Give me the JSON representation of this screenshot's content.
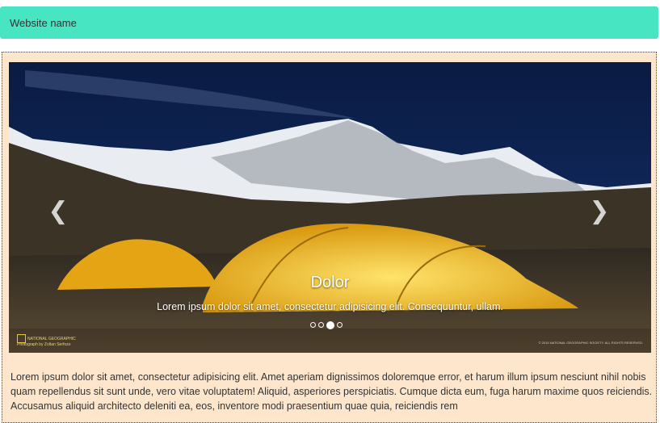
{
  "header": {
    "site_name": "Website name"
  },
  "carousel": {
    "caption_title": "Dolor",
    "caption_text": "Lorem ipsum dolor sit amet, consectetur adipisicing elit. Consequuntur, ullam.",
    "prev_icon": "chevron-left-icon",
    "next_icon": "chevron-right-icon",
    "prev_glyph": "❮",
    "next_glyph": "❯",
    "slide_count": 4,
    "active_index": 2,
    "watermark": "NATIONAL GEOGRAPHIC",
    "photo_credit": "Photograph by Zoltan Serfozo",
    "copyright": "© 2015 NATIONAL GEOGRAPHIC SOCIETY. ALL RIGHTS RESERVED."
  },
  "content": {
    "paragraph": "Lorem ipsum dolor sit amet, consectetur adipisicing elit. Amet aperiam dignissimos doloremque error, et harum illum ipsum nesciunt nihil nobis quam repellendus sit sunt unde, vero vitae voluptatem! Aliquid, asperiores perspiciatis. Cumque dicta eum, fuga harum maxime quos reiciendis. Accusamus aliquid architecto deleniti ea, eos, inventore modi praesentium quae quia, reiciendis rem"
  },
  "colors": {
    "header_bg": "#48e5c2",
    "panel_bg": "#fde6cb",
    "tent": "#f2b81a"
  }
}
